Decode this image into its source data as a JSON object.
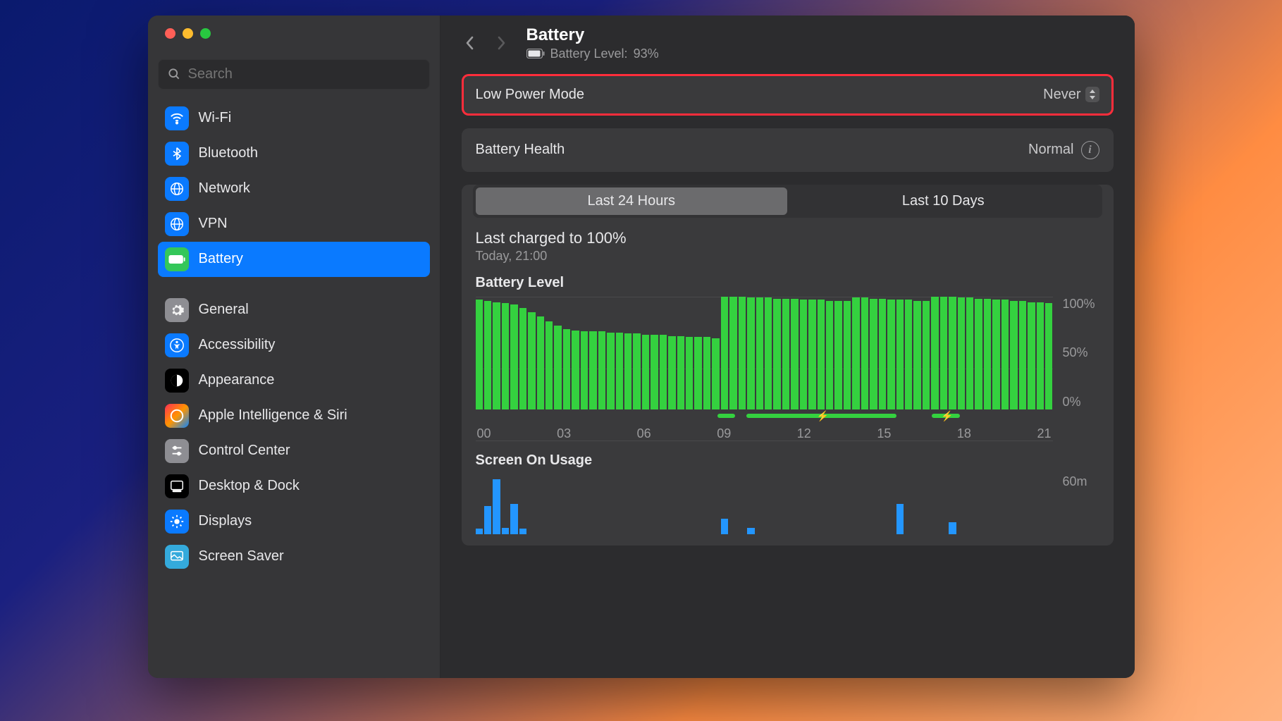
{
  "search": {
    "placeholder": "Search"
  },
  "sidebar": {
    "groups": [
      [
        {
          "label": "Wi-Fi",
          "icon": "wifi",
          "bg": "#0a7aff"
        },
        {
          "label": "Bluetooth",
          "icon": "bluetooth",
          "bg": "#0a7aff"
        },
        {
          "label": "Network",
          "icon": "globe",
          "bg": "#0a7aff"
        },
        {
          "label": "VPN",
          "icon": "vpn",
          "bg": "#0a7aff"
        },
        {
          "label": "Battery",
          "icon": "battery",
          "bg": "#34c759",
          "selected": true
        }
      ],
      [
        {
          "label": "General",
          "icon": "gear",
          "bg": "#8e8e93"
        },
        {
          "label": "Accessibility",
          "icon": "accessibility",
          "bg": "#0a7aff"
        },
        {
          "label": "Appearance",
          "icon": "appearance",
          "bg": "#000000"
        },
        {
          "label": "Apple Intelligence & Siri",
          "icon": "siri",
          "bg": "linear-gradient(135deg,#ff2d55,#ff9500,#0a84ff)"
        },
        {
          "label": "Control Center",
          "icon": "controlcenter",
          "bg": "#8e8e93"
        },
        {
          "label": "Desktop & Dock",
          "icon": "dock",
          "bg": "#000000"
        },
        {
          "label": "Displays",
          "icon": "displays",
          "bg": "#0a7aff"
        },
        {
          "label": "Screen Saver",
          "icon": "screensaver",
          "bg": "#34aadc"
        }
      ]
    ]
  },
  "header": {
    "title": "Battery",
    "subtitle_prefix": "Battery Level:",
    "subtitle_value": "93%"
  },
  "rows": {
    "lpm_label": "Low Power Mode",
    "lpm_value": "Never",
    "health_label": "Battery Health",
    "health_value": "Normal"
  },
  "segments": {
    "a": "Last 24 Hours",
    "b": "Last 10 Days"
  },
  "last_charged": {
    "line": "Last charged to 100%",
    "sub": "Today, 21:00"
  },
  "chart_data": [
    {
      "type": "bar",
      "title": "Battery Level",
      "xlabel": "",
      "ylabel": "",
      "ylim": [
        0,
        100
      ],
      "x_ticks": [
        "00",
        "03",
        "06",
        "09",
        "12",
        "15",
        "18",
        "21"
      ],
      "y_ticks": [
        "100%",
        "50%",
        "0%"
      ],
      "values": [
        97,
        96,
        95,
        94,
        93,
        90,
        86,
        82,
        78,
        74,
        71,
        70,
        69,
        69,
        69,
        68,
        68,
        67,
        67,
        66,
        66,
        66,
        65,
        65,
        64,
        64,
        64,
        63,
        100,
        100,
        100,
        99,
        99,
        99,
        98,
        98,
        98,
        97,
        97,
        97,
        96,
        96,
        96,
        99,
        99,
        98,
        98,
        97,
        97,
        97,
        96,
        96,
        100,
        100,
        100,
        99,
        99,
        98,
        98,
        97,
        97,
        96,
        96,
        95,
        95,
        94
      ],
      "charging_segments": [
        {
          "start_pct": 42,
          "end_pct": 45
        },
        {
          "start_pct": 47,
          "end_pct": 73,
          "bolt": true
        },
        {
          "start_pct": 79,
          "end_pct": 84,
          "bolt": true
        }
      ]
    },
    {
      "type": "bar",
      "title": "Screen On Usage",
      "ylim": [
        0,
        60
      ],
      "y_ticks": [
        "60m"
      ],
      "values": [
        5,
        28,
        55,
        6,
        30,
        5,
        0,
        0,
        0,
        0,
        0,
        0,
        0,
        0,
        0,
        0,
        0,
        0,
        0,
        0,
        0,
        0,
        0,
        0,
        0,
        0,
        0,
        0,
        15,
        0,
        0,
        6,
        0,
        0,
        0,
        0,
        0,
        0,
        0,
        0,
        0,
        0,
        0,
        0,
        0,
        0,
        0,
        0,
        30,
        0,
        0,
        0,
        0,
        0,
        12,
        0,
        0,
        0,
        0,
        0,
        0,
        0,
        0,
        0,
        0,
        0
      ]
    }
  ]
}
